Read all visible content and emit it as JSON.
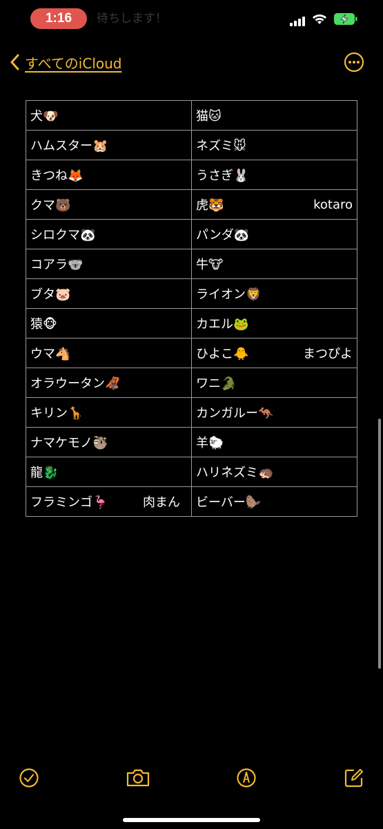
{
  "status_bar": {
    "time": "1:16",
    "behind_text": "待ちします！"
  },
  "nav": {
    "back_label": "すべてのiCloud"
  },
  "colors": {
    "accent": "#f2b935",
    "time_pill": "#e0564e",
    "battery": "#4cd964"
  },
  "table": {
    "rows": [
      [
        {
          "text": "犬🐶"
        },
        {
          "text": "猫🐱"
        }
      ],
      [
        {
          "text": "ハムスター🐹"
        },
        {
          "text": "ネズミ🐭"
        }
      ],
      [
        {
          "text": "きつね🦊"
        },
        {
          "text": "うさぎ🐰"
        }
      ],
      [
        {
          "text": "クマ🐻"
        },
        {
          "text": "虎🐯",
          "note": "kotaro"
        }
      ],
      [
        {
          "text": "シロクマ🐼"
        },
        {
          "text": "パンダ🐼"
        }
      ],
      [
        {
          "text": "コアラ🐨"
        },
        {
          "text": "牛🐮"
        }
      ],
      [
        {
          "text": "ブタ🐷"
        },
        {
          "text": "ライオン🦁"
        }
      ],
      [
        {
          "text": "猿🐵"
        },
        {
          "text": "カエル🐸"
        }
      ],
      [
        {
          "text": "ウマ🐴"
        },
        {
          "text": "ひよこ🐥",
          "note": "まつぴよ"
        }
      ],
      [
        {
          "text": "オラウータン🦧"
        },
        {
          "text": "ワニ🐊"
        }
      ],
      [
        {
          "text": "キリン🦒"
        },
        {
          "text": "カンガルー🦘"
        }
      ],
      [
        {
          "text": "ナマケモノ🦥"
        },
        {
          "text": "羊🐑"
        }
      ],
      [
        {
          "text": "龍🐉"
        },
        {
          "text": "ハリネズミ🦔"
        }
      ],
      [
        {
          "text": "フラミンゴ🦩",
          "note": "肉まん"
        },
        {
          "text": "ビーバー🦫"
        }
      ]
    ]
  },
  "toolbar": {
    "icons": [
      "checklist-icon",
      "camera-icon",
      "markup-pen-icon",
      "compose-icon"
    ]
  }
}
